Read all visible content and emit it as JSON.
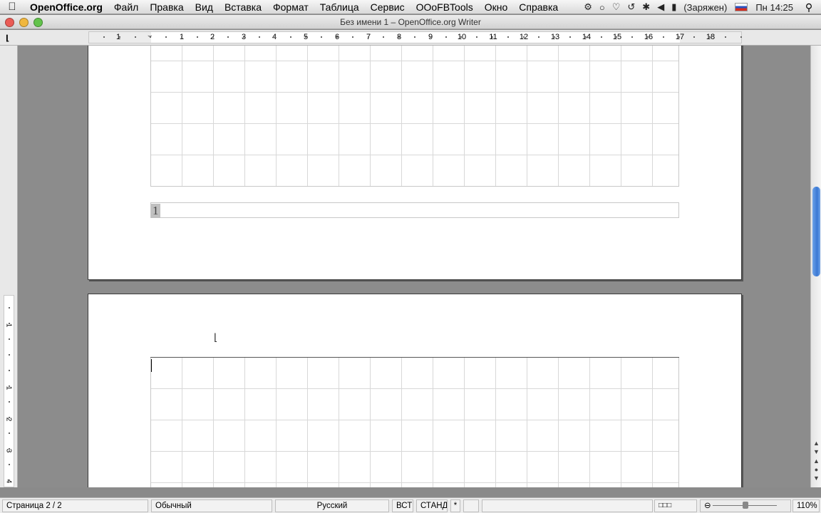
{
  "menubar": {
    "app_name": "OpenOffice.org",
    "items": [
      "Файл",
      "Правка",
      "Вид",
      "Вставка",
      "Формат",
      "Таблица",
      "Сервис",
      "OOoFBTools",
      "Окно",
      "Справка"
    ],
    "battery": "(Заряжен)",
    "clock": "Пн 14:25"
  },
  "window": {
    "title": "Без имени 1 – OpenOffice.org Writer"
  },
  "ruler": {
    "labels": [
      "1",
      "1",
      "2",
      "3",
      "4",
      "5",
      "6",
      "7",
      "8",
      "9",
      "10",
      "11",
      "12",
      "13",
      "14",
      "15",
      "16",
      "17",
      "18"
    ],
    "vertical_labels": [
      "1",
      "1",
      "2",
      "3",
      "4"
    ]
  },
  "document": {
    "footer_page_number": "1"
  },
  "statusbar": {
    "page": "Страница  2 / 2",
    "style": "Обычный",
    "language": "Русский",
    "insert_mode": "ВСТ",
    "selection_mode": "СТАНД",
    "modified": "*",
    "zoom": "110%"
  },
  "icons": {
    "apple": "apple-icon",
    "close": "close-window-icon",
    "minimize": "minimize-window-icon",
    "zoom": "zoom-window-icon",
    "wifi": "wifi-icon",
    "volume": "volume-icon",
    "time_machine": "time-machine-icon",
    "bluetooth": "bluetooth-icon",
    "spotlight": "spotlight-icon"
  }
}
